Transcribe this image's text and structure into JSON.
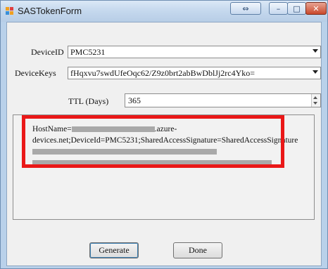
{
  "window": {
    "title": "SASTokenForm",
    "controls": {
      "restore": "⇔",
      "minimize": "–",
      "maximize": "□",
      "close": "✕"
    }
  },
  "form": {
    "device_id_label": "DeviceID",
    "device_id_value": "PMC5231",
    "device_keys_label": "DeviceKeys",
    "device_keys_value": "fHqxvu7swdUfeOqc62/Z9z0brt2abBwDblJj2rc4Yko=",
    "ttl_label": "TTL (Days)",
    "ttl_value": "365"
  },
  "output": {
    "line1_prefix": "HostName=",
    "line1_suffix": ".azure-",
    "line2": "devices.net;DeviceId=PMC5231;SharedAccessSignature=SharedAccessSignature"
  },
  "buttons": {
    "generate": "Generate",
    "done": "Done"
  },
  "colors": {
    "highlight": "#ea1818",
    "window_frame": "#b9d1ea"
  }
}
